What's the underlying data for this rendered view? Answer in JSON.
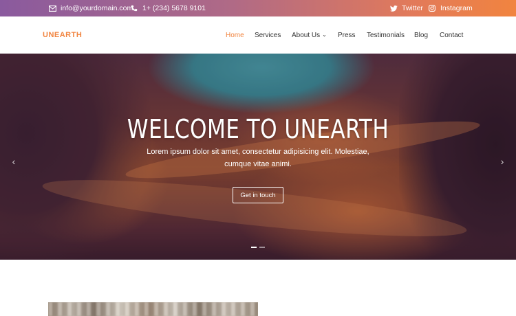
{
  "topbar": {
    "email": "info@yourdomain.com",
    "phone": "1+ (234) 5678 9101",
    "twitter": "Twitter",
    "instagram": "Instagram",
    "icons": [
      "envelope-icon",
      "phone-icon",
      "twitter-icon",
      "instagram-icon"
    ]
  },
  "brand": {
    "logo": "UNEARTH",
    "accent": "#f1843f"
  },
  "nav": {
    "items": [
      {
        "label": "Home",
        "active": true
      },
      {
        "label": "Services"
      },
      {
        "label": "About Us",
        "dropdown": true
      },
      {
        "label": "Press"
      },
      {
        "label": "Testimonials"
      },
      {
        "label": "Blog"
      },
      {
        "label": "Contact"
      }
    ]
  },
  "hero": {
    "title": "WELCOME TO UNEARTH",
    "subtitle": "Lorem ipsum dolor sit amet, consectetur adipisicing elit. Molestiae, cumque vitae animi.",
    "cta": "Get in touch",
    "slides": 2,
    "active_slide": 1
  }
}
